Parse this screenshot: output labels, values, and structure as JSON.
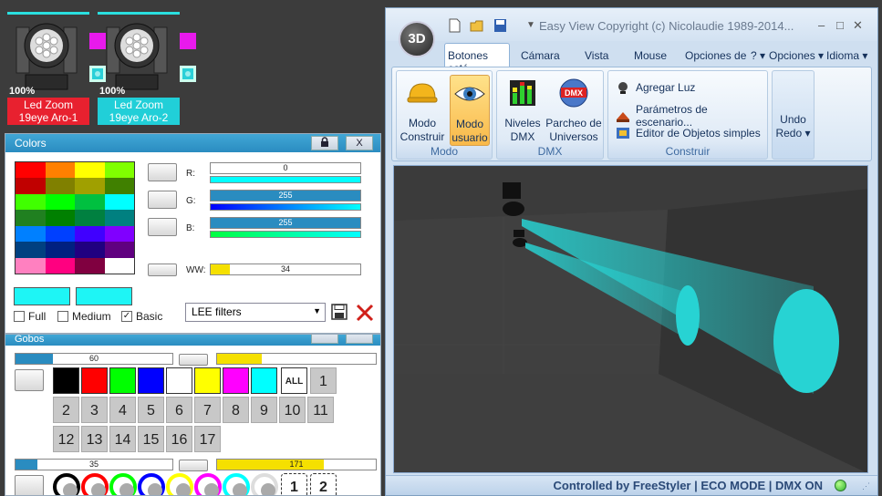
{
  "fixtures": [
    {
      "percent": "100%",
      "name": "Led Zoom",
      "sub": "19eye Aro-1",
      "label_color": "#e8212f"
    },
    {
      "percent": "100%",
      "name": "Led Zoom",
      "sub": "19eye Aro-2",
      "label_color": "#21cfd8"
    }
  ],
  "colors_panel": {
    "title": "Colors",
    "lock_icon": "lock-icon",
    "close_label": "X",
    "palette": [
      "#ff0000",
      "#ff8000",
      "#ffff00",
      "#80ff00",
      "#c00000",
      "#808000",
      "#a0a000",
      "#408000",
      "#40ff00",
      "#00ff00",
      "#00c040",
      "#00ffff",
      "#208020",
      "#008000",
      "#008040",
      "#008080",
      "#0080ff",
      "#0040ff",
      "#4000ff",
      "#8000ff",
      "#004080",
      "#002080",
      "#200080",
      "#600080",
      "#ff80c0",
      "#ff0080",
      "#800040",
      "#ffffff"
    ],
    "r_label": "R:",
    "r_value": "0",
    "r_fill": 0,
    "g_label": "G:",
    "g_value": "255",
    "g_fill": 1,
    "b_label": "B:",
    "b_value": "255",
    "b_fill": 1,
    "ww_label": "WW:",
    "ww_value": "34",
    "ww_fill": 0.13,
    "color_a": "#1ef5f5",
    "color_b": "#1ef5f5",
    "check_full": "Full",
    "check_medium": "Medium",
    "check_basic": "Basic",
    "basic_checked": "✓",
    "filter_value": "LEE filters",
    "save_icon": "save-icon",
    "delete_icon": "delete-icon"
  },
  "gobos_panel": {
    "title": "Gobos",
    "bar1_value": "60",
    "bar1_fill": 0.24,
    "bar3_value": "35",
    "bar3_fill": 0.14,
    "bar4_value": "171",
    "bar4_fill": 0.67,
    "bar2_fill": 0.28,
    "color_cells": [
      "#000000",
      "#ff0000",
      "#00ff00",
      "#0000ff",
      "#ffffff",
      "#ffff00",
      "#ff00ff",
      "#00ffff"
    ],
    "all_label": "ALL",
    "numbers_row1": [
      "1"
    ],
    "numbers_row2": [
      "2",
      "3",
      "4",
      "5",
      "6",
      "7",
      "8",
      "9",
      "10",
      "11"
    ],
    "numbers_row3": [
      "12",
      "13",
      "14",
      "15",
      "16",
      "17"
    ],
    "ring_colors": [
      "#000000",
      "#ff0000",
      "#00ff00",
      "#0000ff",
      "#ffff00",
      "#ff00ff",
      "#00ffff",
      "#ffffff"
    ],
    "ring_nums": [
      "1",
      "2"
    ]
  },
  "window": {
    "logo": "3D",
    "title": "Easy View   Copyright (c) Nicolaudie 1989-2014...",
    "minimize": "–",
    "maximize": "□",
    "close": "✕",
    "tabs": [
      "Botones está",
      "Cámara",
      "Vista",
      "Mouse",
      "Opciones de",
      "? ▾",
      "Opciones ▾",
      "Idioma ▾"
    ],
    "modo_group": "Modo",
    "btn_construir": "Modo\nConstruir",
    "btn_usuario": "Modo\nusuario",
    "dmx_group": "DMX",
    "btn_niveles": "Niveles\nDMX",
    "btn_parcheo": "Parcheo de\nUniversos",
    "dmx_badge": "DMX",
    "construir_group": "Construir",
    "item_agregar": "Agregar Luz",
    "item_parametros": "Parámetros de escenario...",
    "item_editor": "Editor de Objetos simples",
    "undo": "Undo",
    "redo": "Redo ▾",
    "beam_color": "#27d3d3",
    "status": "Controlled by FreeStyler  |  ECO MODE  |  DMX ON"
  }
}
